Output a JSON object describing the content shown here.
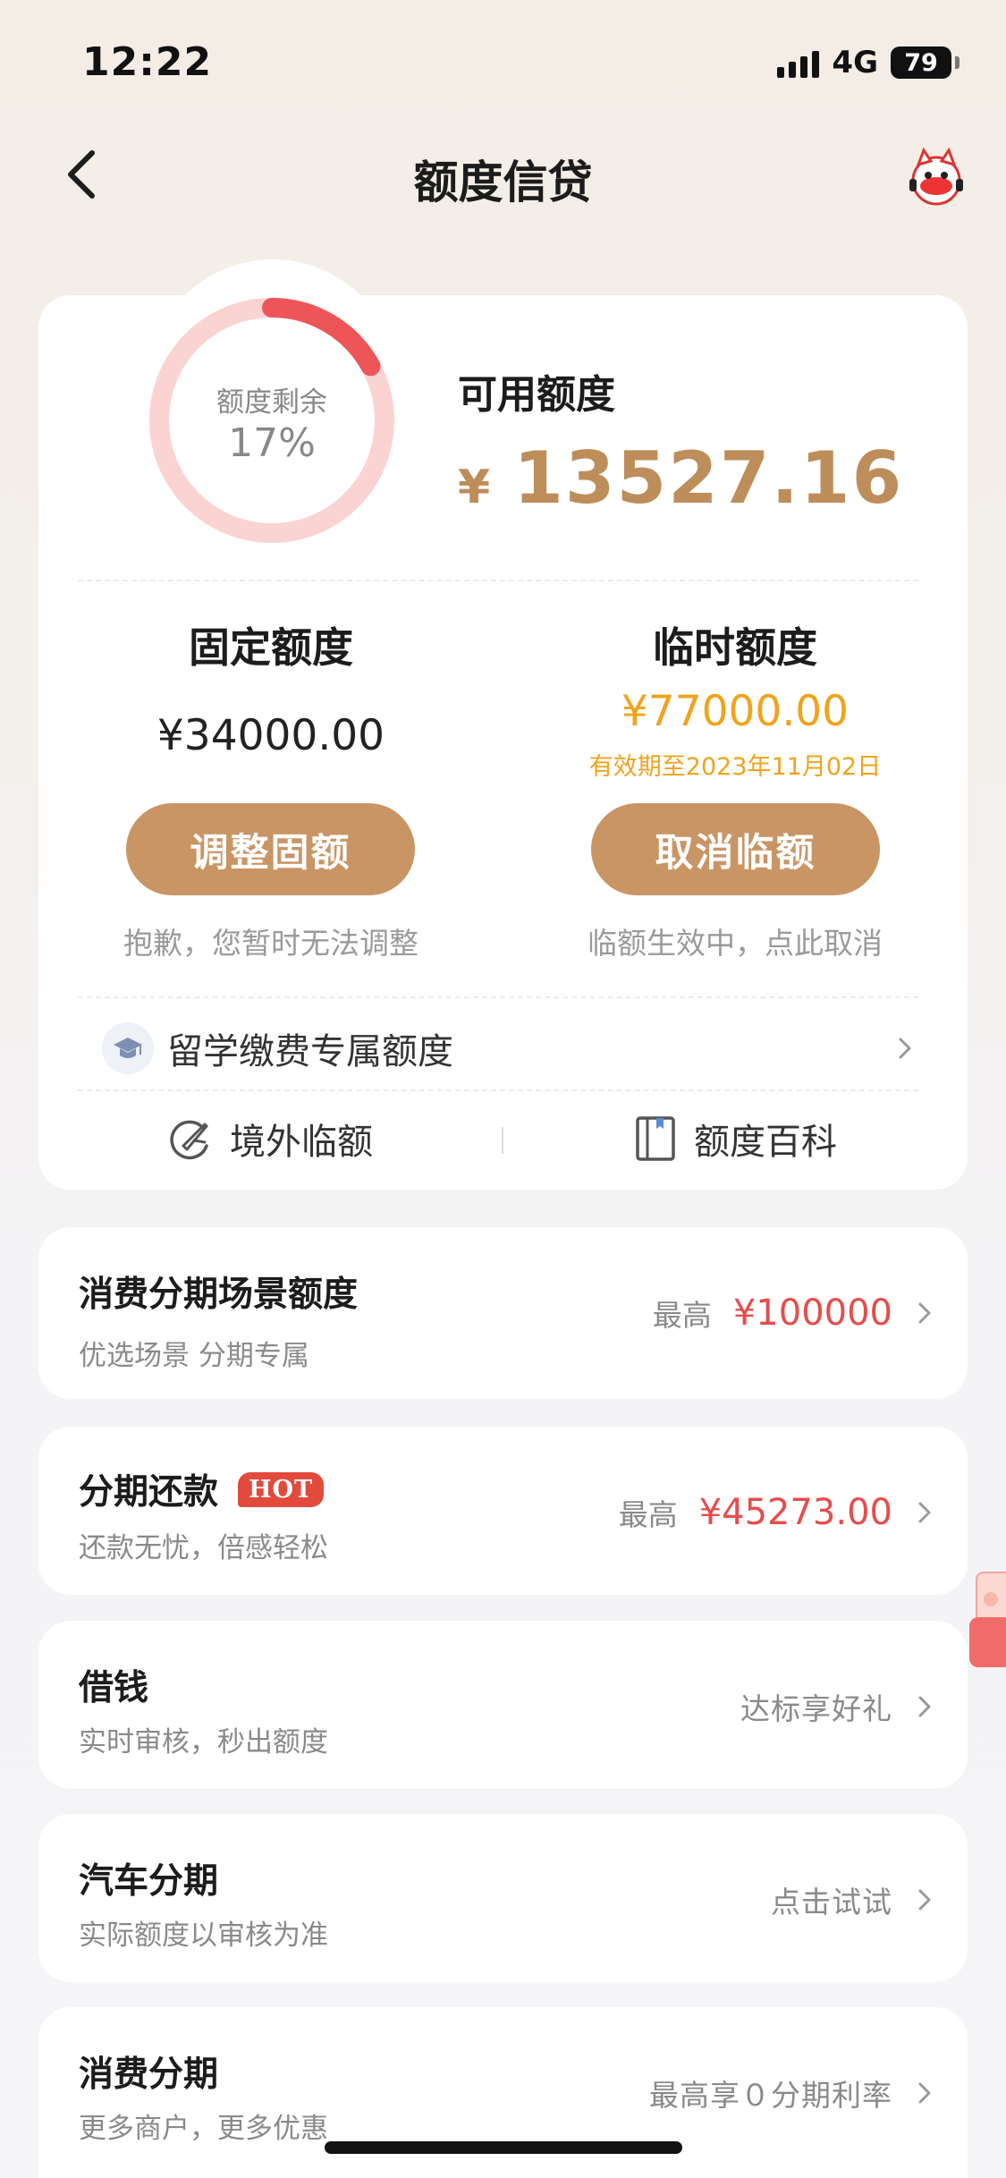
{
  "status_bar": {
    "time": "12:22",
    "network": "4G",
    "battery": "79"
  },
  "nav": {
    "title": "额度信贷",
    "back_icon": "chevron-left-icon",
    "mascot_icon": "mascot-avatar-icon"
  },
  "credit_summary": {
    "ring_label": "额度剩余",
    "ring_value": "17%",
    "remaining_fraction": 0.17,
    "available_title": "可用额度",
    "available_currency": "¥",
    "available_amount": "13527.16"
  },
  "fixed_limit": {
    "title": "固定额度",
    "amount": "¥34000.00",
    "button": "调整固额",
    "note": "抱歉，您暂时无法调整"
  },
  "temp_limit": {
    "title": "临时额度",
    "amount": "¥77000.00",
    "expiry": "有效期至2023年11月02日",
    "button": "取消临额",
    "note": "临额生效中，点此取消"
  },
  "study_abroad": {
    "label": "留学缴费专属额度",
    "icon": "graduation-cap-icon"
  },
  "bottom_links": [
    {
      "label": "境外临额",
      "icon": "plane-icon"
    },
    {
      "label": "额度百科",
      "icon": "book-icon"
    }
  ],
  "list": [
    {
      "title": "消费分期场景额度",
      "subtitle": "优选场景 分期专属",
      "prefix": "最高",
      "amount": "¥100000"
    },
    {
      "title": "分期还款",
      "badge": "HOT",
      "subtitle": "还款无忧，倍感轻松",
      "prefix": "最高",
      "amount": "¥45273.00"
    },
    {
      "title": "借钱",
      "subtitle": "实时审核，秒出额度",
      "right_text": "达标享好礼"
    },
    {
      "title": "汽车分期",
      "subtitle": "实际额度以审核为准",
      "right_text": "点击试试"
    },
    {
      "title": "消费分期",
      "subtitle": "更多商户，更多优惠",
      "right_text": "最高享０分期利率"
    }
  ],
  "colors": {
    "accent_gold": "#c99565",
    "amount_gold": "#bd8d5a",
    "temp_orange": "#f0a31c",
    "price_red": "#e74c4c",
    "hot_red": "#e24a3b",
    "ring_track": "#fbd3d3",
    "ring_progress": "#ee5558"
  }
}
